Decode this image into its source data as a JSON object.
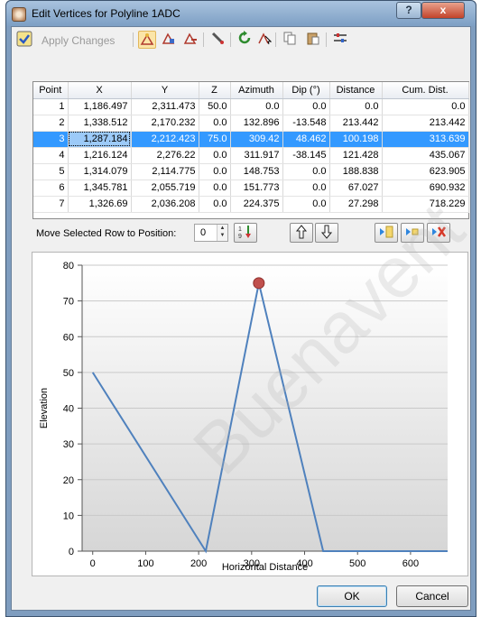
{
  "window": {
    "title": "Edit Vertices for Polyline 1ADC",
    "help": "?",
    "close": "x"
  },
  "toolbar": {
    "apply_label": "Apply Changes"
  },
  "grid": {
    "headers": [
      "Point",
      "X",
      "Y",
      "Z",
      "Azimuth",
      "Dip (°)",
      "Distance",
      "Cum. Dist."
    ],
    "rows": [
      [
        "1",
        "1,186.497",
        "2,311.473",
        "50.0",
        "0.0",
        "0.0",
        "0.0",
        "0.0"
      ],
      [
        "2",
        "1,338.512",
        "2,170.232",
        "0.0",
        "132.896",
        "-13.548",
        "213.442",
        "213.442"
      ],
      [
        "3",
        "1,287.184",
        "2,212.423",
        "75.0",
        "309.42",
        "48.462",
        "100.198",
        "313.639"
      ],
      [
        "4",
        "1,216.124",
        "2,276.22",
        "0.0",
        "311.917",
        "-38.145",
        "121.428",
        "435.067"
      ],
      [
        "5",
        "1,314.079",
        "2,114.775",
        "0.0",
        "148.753",
        "0.0",
        "188.838",
        "623.905"
      ],
      [
        "6",
        "1,345.781",
        "2,055.719",
        "0.0",
        "151.773",
        "0.0",
        "67.027",
        "690.932"
      ],
      [
        "7",
        "1,326.69",
        "2,036.208",
        "0.0",
        "224.375",
        "0.0",
        "27.298",
        "718.229"
      ]
    ],
    "selected_row": 2
  },
  "move_row": {
    "label": "Move Selected Row to Position:",
    "value": "0"
  },
  "chart_data": {
    "type": "line",
    "xlabel": "Horizontal Distance",
    "ylabel": "Elevation",
    "xlim": [
      -20,
      670
    ],
    "ylim": [
      0,
      80
    ],
    "xticks": [
      0,
      100,
      200,
      300,
      400,
      500,
      600
    ],
    "yticks": [
      0,
      10,
      20,
      30,
      40,
      50,
      60,
      70,
      80
    ],
    "series": [
      {
        "x": [
          0,
          213.442,
          313.639,
          435.067,
          623.905,
          690.932,
          718.229
        ],
        "y": [
          50,
          0,
          75,
          0,
          0,
          0,
          0
        ]
      }
    ],
    "highlight_point": {
      "x": 313.639,
      "y": 75
    },
    "line_color": "#4f81bd",
    "marker_color": "#c0504d",
    "grid": true
  },
  "watermark": "Buenavent",
  "buttons": {
    "ok": "OK",
    "cancel": "Cancel"
  }
}
